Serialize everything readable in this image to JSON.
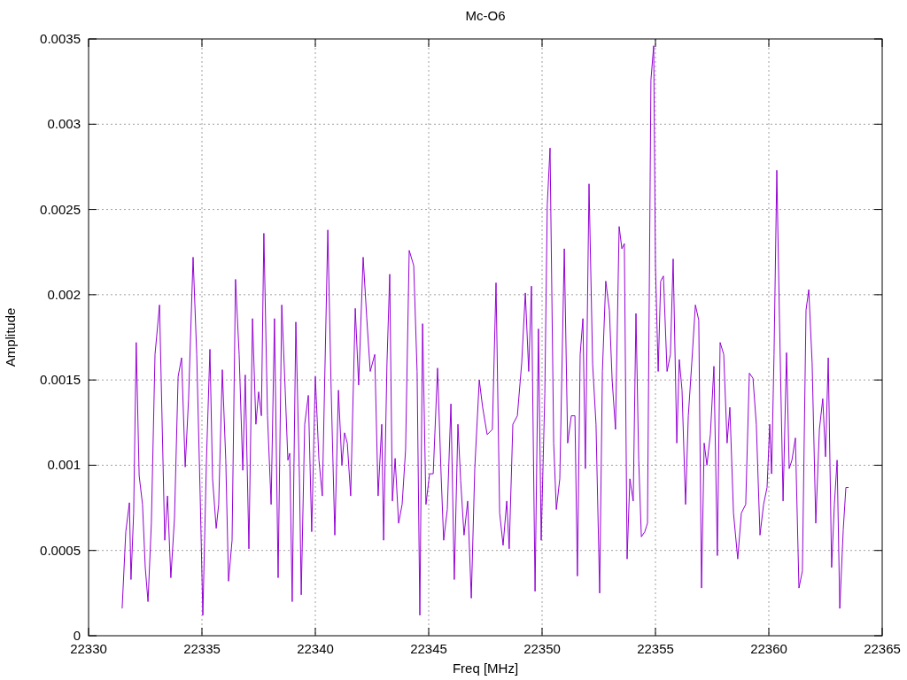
{
  "chart_data": {
    "type": "line",
    "title": "Mc-O6",
    "xlabel": "Freq [MHz]",
    "ylabel": "Amplitude",
    "grid": true,
    "xlim": [
      22330,
      22365
    ],
    "ylim": [
      0,
      0.0035
    ],
    "xticks": [
      22330,
      22335,
      22340,
      22345,
      22350,
      22355,
      22360,
      22365
    ],
    "yticks": [
      0,
      0.0005,
      0.001,
      0.0015,
      0.002,
      0.0025,
      0.003,
      0.0035
    ],
    "x": [
      22331.48,
      22331.64,
      22331.8,
      22331.87,
      22331.99,
      22332.1,
      22332.23,
      22332.38,
      22332.5,
      22332.62,
      22332.77,
      22332.93,
      22333.13,
      22333.36,
      22333.48,
      22333.63,
      22333.79,
      22333.95,
      22334.1,
      22334.26,
      22334.41,
      22334.61,
      22334.77,
      22334.92,
      22335.04,
      22335.2,
      22335.35,
      22335.47,
      22335.63,
      22335.74,
      22335.9,
      22336.05,
      22336.17,
      22336.33,
      22336.48,
      22336.64,
      22336.8,
      22336.91,
      22337.07,
      22337.23,
      22337.38,
      22337.5,
      22337.62,
      22337.73,
      22337.89,
      22338.05,
      22338.2,
      22338.36,
      22338.52,
      22338.67,
      22338.79,
      22338.87,
      22338.98,
      22339.14,
      22339.3,
      22339.38,
      22339.53,
      22339.69,
      22339.84,
      22340,
      22340.16,
      22340.31,
      22340.55,
      22340.7,
      22340.86,
      22341.02,
      22341.17,
      22341.29,
      22341.41,
      22341.56,
      22341.76,
      22341.91,
      22342.11,
      22342.27,
      22342.42,
      22342.62,
      22342.77,
      22342.93,
      22343.01,
      22343.16,
      22343.28,
      22343.4,
      22343.52,
      22343.67,
      22343.83,
      22343.98,
      22344.14,
      22344.34,
      22344.49,
      22344.61,
      22344.73,
      22344.88,
      22345.04,
      22345.2,
      22345.39,
      22345.55,
      22345.66,
      22345.82,
      22345.98,
      22346.13,
      22346.29,
      22346.41,
      22346.56,
      22346.72,
      22346.88,
      22347.03,
      22347.23,
      22347.38,
      22347.58,
      22347.81,
      22347.97,
      22348.13,
      22348.28,
      22348.44,
      22348.55,
      22348.71,
      22348.91,
      22349.1,
      22349.26,
      22349.41,
      22349.53,
      22349.69,
      22349.84,
      22349.96,
      22350.12,
      22350.23,
      22350.35,
      22350.51,
      22350.63,
      22350.78,
      22350.98,
      22351.13,
      22351.29,
      22351.45,
      22351.56,
      22351.68,
      22351.8,
      22351.91,
      22352.07,
      22352.23,
      22352.38,
      22352.54,
      22352.66,
      22352.81,
      22352.97,
      22353.09,
      22353.24,
      22353.4,
      22353.52,
      22353.63,
      22353.75,
      22353.87,
      22354.02,
      22354.14,
      22354.26,
      22354.38,
      22354.53,
      22354.65,
      22354.8,
      22354.92,
      22355,
      22355.12,
      22355.23,
      22355.35,
      22355.51,
      22355.66,
      22355.78,
      22355.94,
      22356.05,
      22356.17,
      22356.33,
      22356.45,
      22356.6,
      22356.76,
      22356.91,
      22357.03,
      22357.15,
      22357.27,
      22357.42,
      22357.58,
      22357.73,
      22357.85,
      22358.01,
      22358.16,
      22358.28,
      22358.44,
      22358.63,
      22358.79,
      22358.98,
      22359.14,
      22359.3,
      22359.45,
      22359.61,
      22359.77,
      22359.92,
      22360.04,
      22360.12,
      22360.23,
      22360.35,
      22360.47,
      22360.63,
      22360.78,
      22360.9,
      22361.02,
      22361.17,
      22361.33,
      22361.48,
      22361.64,
      22361.76,
      22361.91,
      22362.07,
      22362.23,
      22362.38,
      22362.5,
      22362.62,
      22362.77,
      22362.89,
      22363.01,
      22363.13,
      22363.28,
      22363.4,
      22363.52
    ],
    "series": [
      {
        "color": "#9400d3",
        "values": [
          0.00016,
          0.00061,
          0.00078,
          0.00033,
          0.00072,
          0.00172,
          0.00094,
          0.00077,
          0.0004,
          0.0002,
          0.00066,
          0.00165,
          0.00194,
          0.00056,
          0.00082,
          0.00034,
          0.00069,
          0.00152,
          0.00163,
          0.00099,
          0.00139,
          0.00222,
          0.00165,
          0.00082,
          0.00012,
          0.00103,
          0.00168,
          0.00092,
          0.00063,
          0.00077,
          0.00156,
          0.00103,
          0.00032,
          0.00056,
          0.00209,
          0.00165,
          0.00097,
          0.00153,
          0.00051,
          0.00186,
          0.00124,
          0.00143,
          0.00129,
          0.00236,
          0.00129,
          0.00077,
          0.00186,
          0.00034,
          0.00194,
          0.00144,
          0.00103,
          0.00107,
          0.0002,
          0.00184,
          0.00092,
          0.00024,
          0.00124,
          0.00141,
          0.00061,
          0.00152,
          0.00103,
          0.00082,
          0.00238,
          0.00144,
          0.00059,
          0.00144,
          0.001,
          0.00119,
          0.00113,
          0.00082,
          0.00192,
          0.00147,
          0.00222,
          0.00186,
          0.00155,
          0.00165,
          0.00082,
          0.00124,
          0.00056,
          0.0016,
          0.00212,
          0.00079,
          0.00104,
          0.00066,
          0.00077,
          0.00109,
          0.00226,
          0.00217,
          0.00155,
          0.00012,
          0.00183,
          0.00077,
          0.00095,
          0.00095,
          0.00157,
          0.00093,
          0.00056,
          0.00074,
          0.00136,
          0.00033,
          0.00124,
          0.00091,
          0.00059,
          0.00079,
          0.00022,
          0.00098,
          0.0015,
          0.00134,
          0.00118,
          0.00121,
          0.00207,
          0.00072,
          0.00053,
          0.00079,
          0.00051,
          0.00124,
          0.00129,
          0.0016,
          0.00201,
          0.00155,
          0.00205,
          0.00026,
          0.0018,
          0.00056,
          0.00142,
          0.00253,
          0.00286,
          0.00113,
          0.00074,
          0.00092,
          0.00227,
          0.00113,
          0.00129,
          0.00129,
          0.00035,
          0.00165,
          0.00186,
          0.00098,
          0.00265,
          0.00159,
          0.00124,
          0.00025,
          0.00155,
          0.00208,
          0.00191,
          0.0015,
          0.00121,
          0.0024,
          0.00227,
          0.0023,
          0.00045,
          0.00092,
          0.00079,
          0.00189,
          0.00103,
          0.00058,
          0.00061,
          0.00066,
          0.00326,
          0.00346,
          0.00217,
          0.00155,
          0.00208,
          0.00211,
          0.00155,
          0.00165,
          0.00221,
          0.00113,
          0.00162,
          0.00144,
          0.00077,
          0.00129,
          0.0016,
          0.00194,
          0.00185,
          0.00028,
          0.00113,
          0.001,
          0.00118,
          0.00158,
          0.00047,
          0.00172,
          0.00165,
          0.00113,
          0.00134,
          0.00072,
          0.00045,
          0.00072,
          0.00077,
          0.00154,
          0.00151,
          0.00124,
          0.00059,
          0.00077,
          0.00087,
          0.00124,
          0.00095,
          0.00165,
          0.00273,
          0.00186,
          0.00079,
          0.00166,
          0.00098,
          0.00103,
          0.00116,
          0.00028,
          0.00038,
          0.00191,
          0.00203,
          0.0016,
          0.00066,
          0.00121,
          0.00139,
          0.00105,
          0.00163,
          0.0004,
          0.00077,
          0.00103,
          0.00016,
          0.00062,
          0.00087,
          0.00087
        ]
      }
    ]
  }
}
